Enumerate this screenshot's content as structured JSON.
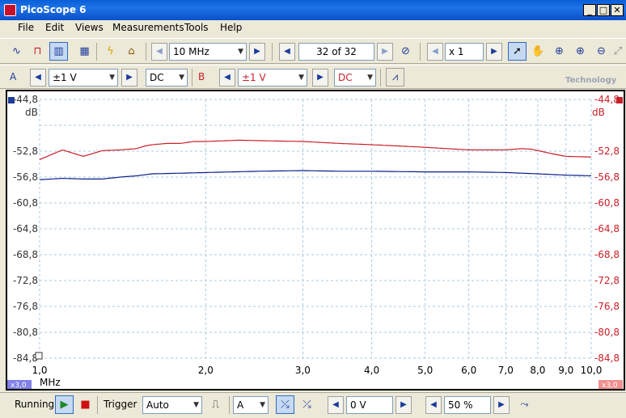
{
  "window": {
    "title": "PicoScope 6",
    "minimize": "_",
    "maximize": "□",
    "close": "✕"
  },
  "menu": [
    "File",
    "Edit",
    "Views",
    "Measurements",
    "Tools",
    "Help"
  ],
  "toolbar1": {
    "timebase": "10 MHz",
    "buffer": "32 of 32",
    "zoom": "x 1"
  },
  "toolbar2": {
    "channel_a_label": "A",
    "channel_a_range": "±1 V",
    "channel_a_coupling": "DC",
    "channel_b_label": "B",
    "channel_b_range": "±1 V",
    "channel_b_coupling": "DC",
    "brand_text": "Technology"
  },
  "scope": {
    "left_scale_label": "x3,0",
    "right_scale_label": "x3,0",
    "unit_left": "dB",
    "unit_right": "dB",
    "x_unit": "MHz",
    "colors": {
      "channel_a": "#0a1e8a",
      "channel_b": "#c8202a",
      "grid": "#a8c8e0"
    }
  },
  "status": {
    "run_state": "Running",
    "trigger_label": "Trigger",
    "trigger_mode": "Auto",
    "trigger_source": "A",
    "trigger_level": "0 V",
    "pretrigger": "50 %"
  },
  "chart_data": {
    "type": "line",
    "xscale": "log",
    "xlim": [
      1.0,
      10.0
    ],
    "ylim": [
      -84.8,
      -44.8
    ],
    "x_ticks": [
      "1,0",
      "2,0",
      "3,0",
      "4,0",
      "5,0",
      "6,0",
      "7,0",
      "8,0",
      "9,0",
      "10,0"
    ],
    "x_tick_values": [
      1,
      2,
      3,
      4,
      5,
      6,
      7,
      8,
      9,
      10
    ],
    "y_ticks": [
      "-44,8",
      "-52,8",
      "-56,8",
      "-60,8",
      "-64,8",
      "-68,8",
      "-72,8",
      "-76,8",
      "-80,8",
      "-84,8"
    ],
    "y_tick_values": [
      -44.8,
      -52.8,
      -56.8,
      -60.8,
      -64.8,
      -68.8,
      -72.8,
      -76.8,
      -80.8,
      -84.8
    ],
    "y_grid_values": [
      -44.8,
      -48.8,
      -52.8,
      -56.8,
      -60.8,
      -64.8,
      -68.8,
      -72.8,
      -76.8,
      -80.8,
      -84.8
    ],
    "series": [
      {
        "channel": "B",
        "color": "#c8202a",
        "x": [
          1.0,
          1.1,
          1.2,
          1.3,
          1.4,
          1.5,
          1.55,
          1.6,
          1.7,
          1.8,
          1.9,
          2.0,
          2.3,
          2.6,
          3.0,
          3.5,
          4.0,
          4.5,
          5.0,
          6.0,
          7.0,
          7.5,
          7.8,
          8.5,
          9.0,
          10.0
        ],
        "y": [
          -54.1,
          -52.6,
          -53.6,
          -52.7,
          -52.6,
          -52.4,
          -52.0,
          -51.8,
          -51.6,
          -51.6,
          -51.3,
          -51.3,
          -51.1,
          -51.2,
          -51.3,
          -51.6,
          -51.8,
          -52.0,
          -52.2,
          -52.6,
          -52.6,
          -52.4,
          -52.5,
          -53.2,
          -53.6,
          -53.7
        ]
      },
      {
        "channel": "A",
        "color": "#0a1e8a",
        "x": [
          1.0,
          1.1,
          1.2,
          1.3,
          1.4,
          1.5,
          1.6,
          1.8,
          2.0,
          2.5,
          3.0,
          3.5,
          4.0,
          5.0,
          6.0,
          7.0,
          8.0,
          9.0,
          10.0
        ],
        "y": [
          -57.2,
          -57.0,
          -57.1,
          -57.1,
          -56.8,
          -56.6,
          -56.3,
          -56.2,
          -56.1,
          -55.9,
          -55.8,
          -55.9,
          -55.9,
          -56.0,
          -56.0,
          -56.1,
          -56.3,
          -56.5,
          -56.6
        ]
      }
    ]
  }
}
